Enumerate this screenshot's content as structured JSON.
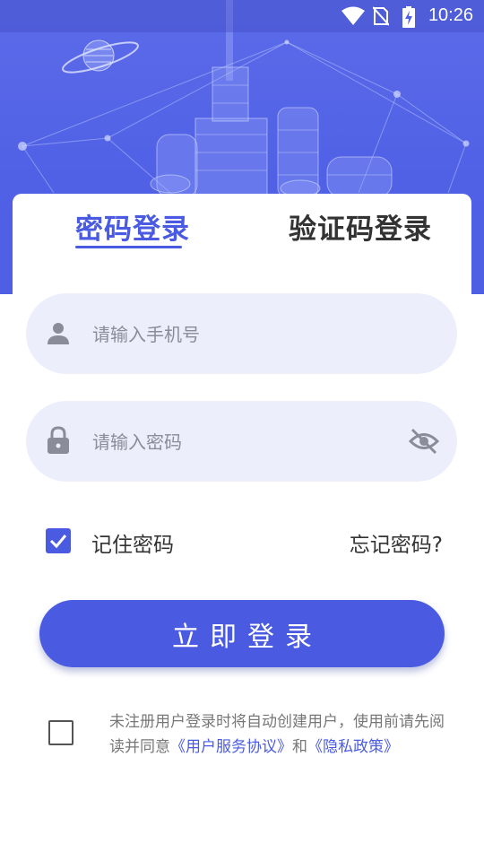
{
  "status_bar": {
    "time": "10:26",
    "icons": [
      "wifi-icon",
      "no-sim-icon",
      "battery-charging-icon"
    ]
  },
  "tabs": [
    {
      "label": "密码登录",
      "active": true
    },
    {
      "label": "验证码登录",
      "active": false
    }
  ],
  "phone_field": {
    "placeholder": "请输入手机号",
    "value": "",
    "icon": "person-icon"
  },
  "password_field": {
    "placeholder": "请输入密码",
    "value": "",
    "icon": "lock-icon",
    "toggle_icon": "eye-off-icon"
  },
  "remember": {
    "label": "记住密码",
    "checked": true
  },
  "forgot_label": "忘记密码?",
  "login_button": "立即登录",
  "agreement": {
    "checked": false,
    "text_before": "未注册用户登录时将自动创建用户，使用前请先阅读并同意",
    "link1": "《用户服务协议》",
    "middle": "和",
    "link2": "《隐私政策》"
  },
  "colors": {
    "accent": "#4a5be2",
    "input_bg": "#eceffb",
    "header": "#5161e6"
  }
}
